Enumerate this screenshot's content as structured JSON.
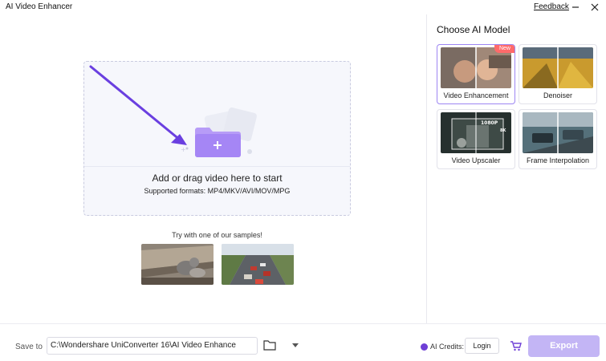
{
  "window": {
    "title": "AI Video Enhancer",
    "feedback_label": "Feedback"
  },
  "dropzone": {
    "title": "Add or drag video here to start",
    "formats": "Supported formats: MP4/MKV/AVI/MOV/MPG"
  },
  "samples": {
    "label": "Try with one of our samples!"
  },
  "models": {
    "title": "Choose AI Model",
    "items": [
      {
        "label": "Video Enhancement",
        "badge": "New",
        "selected": true
      },
      {
        "label": "Denoiser"
      },
      {
        "label": "Video Upscaler",
        "thumb_text_1": "1080P",
        "thumb_text_2": "8K"
      },
      {
        "label": "Frame Interpolation"
      }
    ]
  },
  "bottom": {
    "save_label": "Save to",
    "save_path": "C:\\Wondershare UniConverter 16\\AI Video Enhance",
    "credits_label": "AI Credits:",
    "login_label": "Login",
    "export_label": "Export"
  },
  "colors": {
    "accent": "#7a52e8",
    "export_disabled": "#c3b5f5",
    "badge": "#ff6a6a"
  },
  "icons": [
    "minimize-icon",
    "close-icon",
    "plus-folder-icon",
    "arrow-icon",
    "chevron-down-icon",
    "folder-icon",
    "credits-icon",
    "cart-icon"
  ]
}
